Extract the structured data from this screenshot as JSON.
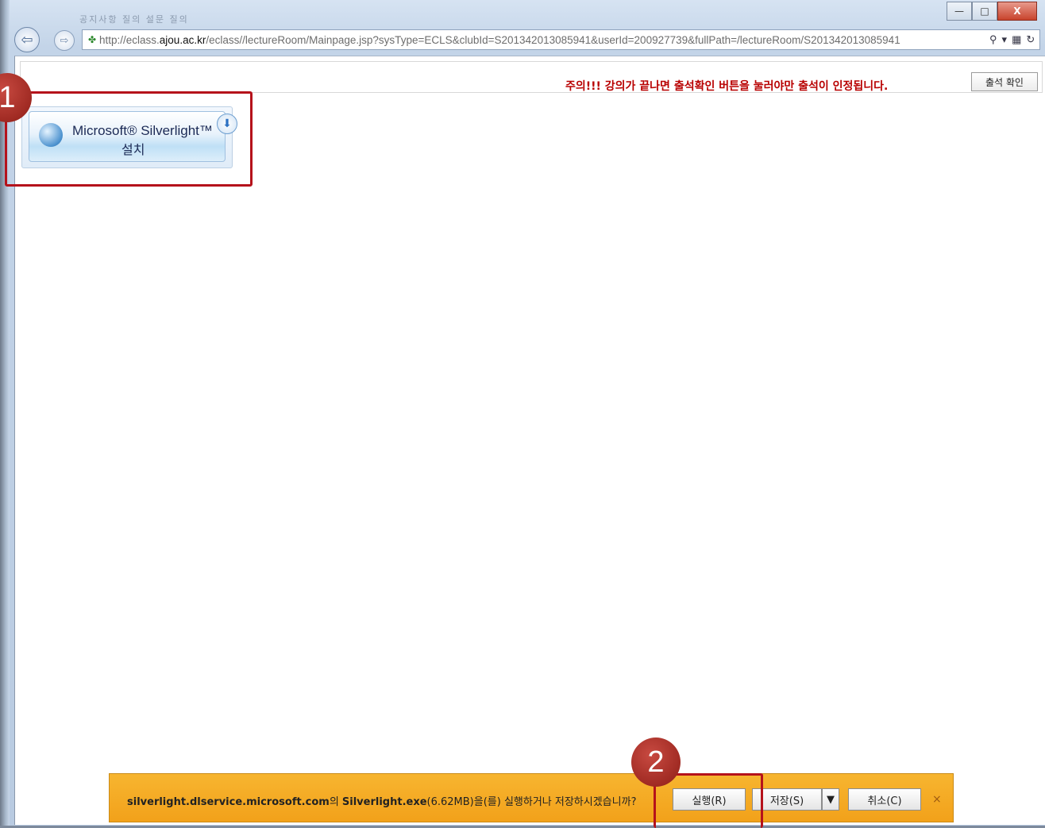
{
  "browser": {
    "tab_strip": "공지사항  질의  설문  질의",
    "url_prefix": "http://eclass.",
    "url_domain": "ajou.ac.kr",
    "url_rest": "/eclass//lectureRoom/Mainpage.jsp?sysType=ECLS&clubId=S201342013085941&userId=200927739&fullPath=/lectureRoom/S201342013085941",
    "minimize": "—",
    "maximize": "□",
    "close": "X"
  },
  "page": {
    "notice": "주의!!! 강의가 끝나면 출석확인 버튼을 눌러야만 출석이 인정됩니다.",
    "attend_button": "출석 확인",
    "silverlight_title": "Microsoft® Silverlight™",
    "silverlight_install": "설치"
  },
  "download_bar": {
    "site": "silverlight.dlservice.microsoft.com",
    "site_suffix": "의 ",
    "file": "Silverlight.exe",
    "message_rest": "(6.62MB)을(를) 실행하거나 저장하시겠습니까?",
    "run_button": "실행(R)",
    "save_button": "저장(S)",
    "cancel_button": "취소(C)",
    "close": "×"
  },
  "markers": {
    "one": "1",
    "two": "2"
  },
  "colors": {
    "callout": "#b5121b",
    "notice": "#b80000",
    "download_bar": "#f2a11a"
  }
}
